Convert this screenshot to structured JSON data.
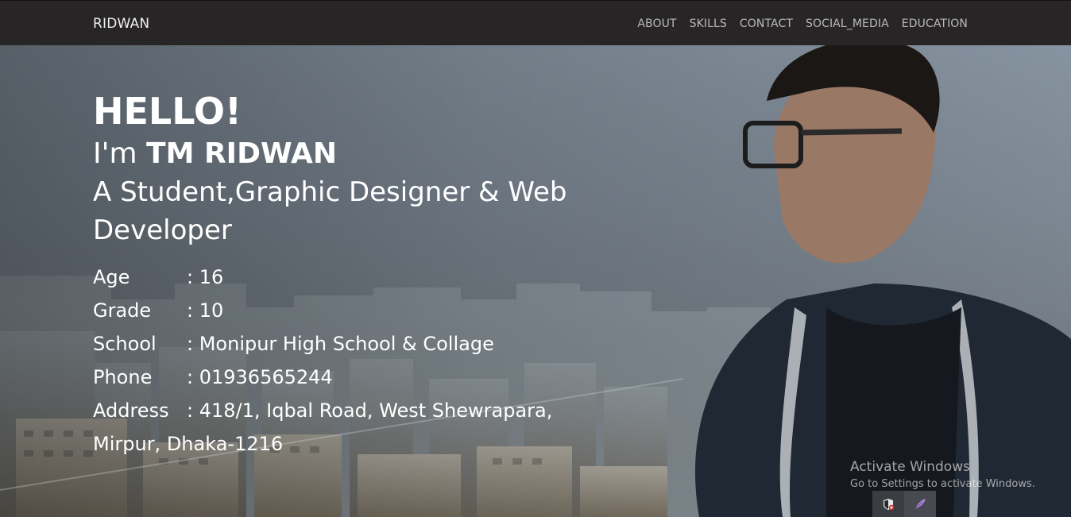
{
  "nav": {
    "brand": "RIDWAN",
    "links": [
      "ABOUT",
      "SKILLS",
      "CONTACT",
      "SOCIAL_MEDIA",
      "EDUCATION"
    ]
  },
  "hero": {
    "greeting": "HELLO!",
    "intro_prefix": "I'm",
    "name": "TM RIDWAN",
    "role": "A Student,Graphic Designer & Web Developer",
    "details": [
      {
        "label": "Age",
        "value": ": 16"
      },
      {
        "label": "Grade",
        "value": ": 10"
      },
      {
        "label": "School",
        "value": ": Monipur High School & Collage"
      },
      {
        "label": "Phone",
        "value": ": 01936565244"
      },
      {
        "label": "Address",
        "value": ": 418/1, Iqbal Road, West Shewrapara,"
      }
    ],
    "address_continued": "Mirpur, Dhaka-1216"
  },
  "watermark": {
    "title": "Activate Windows",
    "subtitle": "Go to Settings to activate Windows."
  },
  "tray": {
    "icons": [
      "security-shield-icon",
      "feather-pen-icon"
    ]
  },
  "colors": {
    "navbar": "#282526",
    "nav_link": "#b9b9b9",
    "hero_text": "#ffffff"
  }
}
